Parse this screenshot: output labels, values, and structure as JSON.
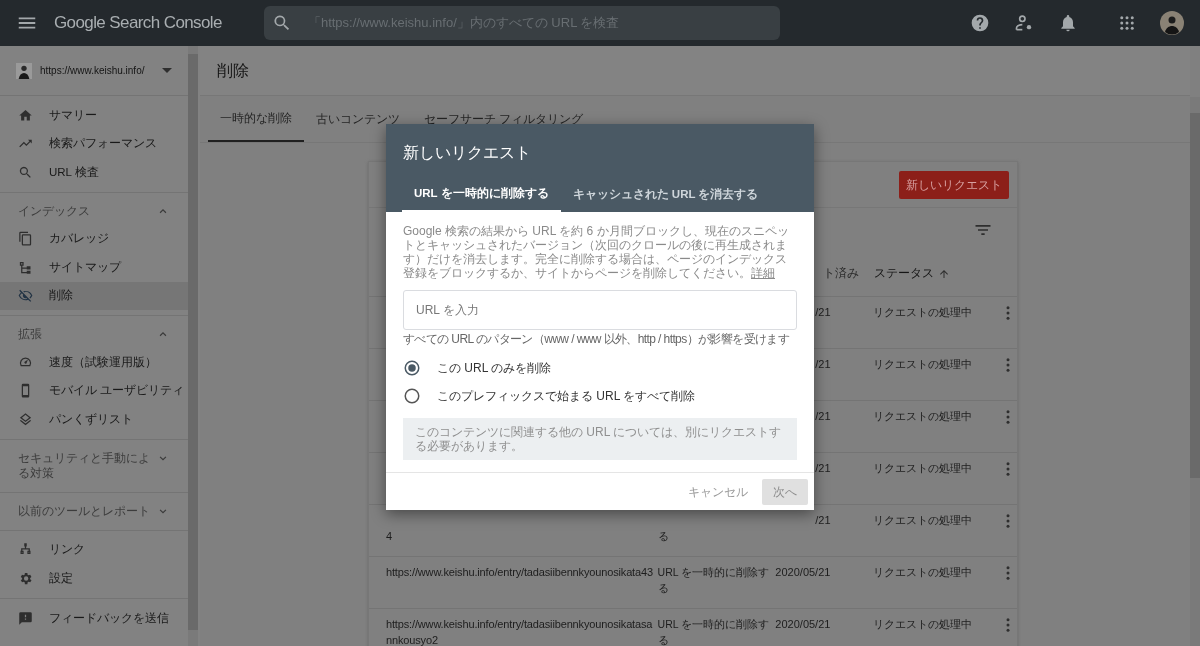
{
  "app": {
    "title": "Google Search Console",
    "search": {
      "placeholder": "「https://www.keishu.info/」内のすべての URL を検査"
    }
  },
  "property": {
    "label": "https://www.keishu.info/"
  },
  "sidebar": {
    "sections": [
      {
        "items": [
          {
            "label": "サマリー",
            "selected": false
          },
          {
            "label": "検索パフォーマンス",
            "selected": false
          },
          {
            "label": "URL 検査",
            "selected": false
          }
        ]
      },
      {
        "heading": "インデックス",
        "expanded": true,
        "items": [
          {
            "label": "カバレッジ",
            "selected": false
          },
          {
            "label": "サイトマップ",
            "selected": false
          },
          {
            "label": "削除",
            "selected": true
          }
        ]
      },
      {
        "heading": "拡張",
        "expanded": true,
        "items": [
          {
            "label": "速度（試験運用版）",
            "selected": false
          },
          {
            "label": "モバイル ユーザビリティ",
            "selected": false
          },
          {
            "label": "パンくずリスト",
            "selected": false
          }
        ]
      },
      {
        "heading": "セキュリティと手動による対策",
        "expanded": false
      },
      {
        "heading": "以前のツールとレポート",
        "expanded": false
      },
      {
        "items": [
          {
            "label": "リンク",
            "selected": false
          },
          {
            "label": "設定",
            "selected": false
          }
        ]
      },
      {
        "items": [
          {
            "label": "フィードバックを送信",
            "selected": false
          }
        ]
      }
    ]
  },
  "page": {
    "title": "削除",
    "tabs": [
      {
        "label": "一時的な削除",
        "selected": true
      },
      {
        "label": "古いコンテンツ",
        "selected": false
      },
      {
        "label": "セーフサーチ フィルタリング",
        "selected": false
      }
    ],
    "card": {
      "button": "新しいリクエスト",
      "table": {
        "columns": [
          {
            "label": "ト済み",
            "sorted": false
          },
          {
            "label": "ステータス",
            "sorted": true
          }
        ],
        "rows": [
          {
            "date": "/21",
            "status": "リクエストの処理中"
          },
          {
            "date": "/21",
            "status": "リクエストの処理中"
          },
          {
            "date": "/21",
            "status": "リクエストの処理中"
          },
          {
            "date": "/21",
            "status": "リクエストの処理中"
          },
          {
            "url": "4",
            "type": "る",
            "date": "/21",
            "status": "リクエストの処理中"
          },
          {
            "url": "https://www.keishu.info/entry/tadasiibennkyounosikata43",
            "type": "URL を一時的に削除する",
            "date": "2020/05/21",
            "status": "リクエストの処理中"
          },
          {
            "url": "https://www.keishu.info/entry/tadasiibennkyounosikatasannkousyo2",
            "type": "URL を一時的に削除する",
            "date": "2020/05/21",
            "status": "リクエストの処理中"
          }
        ]
      }
    }
  },
  "dialog": {
    "title": "新しいリクエスト",
    "tabs": [
      {
        "label": "URL を一時的に削除する",
        "selected": true
      },
      {
        "label": "キャッシュされた URL を消去する",
        "selected": false
      }
    ],
    "description": "Google 検索の結果から URL を約 6 か月間ブロックし、現在のスニペットとキャッシュされたバージョン（次回のクロールの後に再生成されます）だけを消去します。完全に削除する場合は、ページのインデックス登録をブロックするか、サイトからページを削除してください。",
    "link": "詳細",
    "input": {
      "placeholder": "URL を入力"
    },
    "helper": "すべての URL のパターン（www / www 以外、http / https）が影響を受けます",
    "options": [
      {
        "label": "この URL のみを削除",
        "selected": true
      },
      {
        "label": "このプレフィックスで始まる URL をすべて削除",
        "selected": false
      }
    ],
    "note": "このコンテンツに関連する他の URL については、別にリクエストする必要があります。",
    "cancel": "キャンセル",
    "next": {
      "label": "次へ",
      "disabled": true
    }
  }
}
